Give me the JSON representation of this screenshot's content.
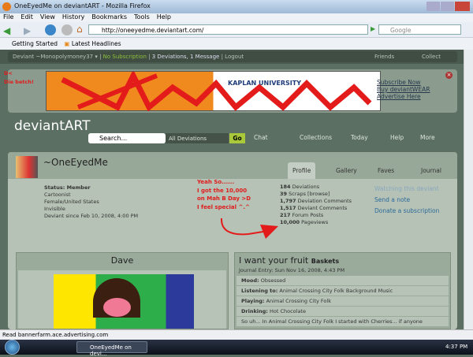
{
  "browser": {
    "title": "OneEyedMe on deviantART - Mozilla Firefox",
    "menu": [
      "File",
      "Edit",
      "View",
      "History",
      "Bookmarks",
      "Tools",
      "Help"
    ],
    "url": "http://oneeyedme.deviantart.com/",
    "search_placeholder": "Google",
    "bookmarks": [
      "Getting Started",
      "Latest Headlines"
    ],
    "status": "Read bannerfarm.ace.advertising.com"
  },
  "dabar": {
    "user": "Deviant ~Monopolymoney37",
    "subscription": "No Subscription",
    "counts": "3 Deviations, 1 Message",
    "logout": "Logout",
    "friends": "Friends",
    "collect": "Collect"
  },
  "ad": {
    "scribble": "D<\nDie betch!",
    "links": [
      "Subscribe Now",
      "Buy deviantWEAR",
      "Advertise Here"
    ],
    "brand": "KAPLAN UNIVERSITY"
  },
  "header": {
    "logo": "deviantART",
    "search_placeholder": "Search...",
    "scope": "All Deviations",
    "go": "Go",
    "nav": [
      "Chat",
      "Collections",
      "Today",
      "Help",
      "More"
    ]
  },
  "profile": {
    "name": "~OneEyedMe",
    "tabs": [
      "Profile",
      "Gallery",
      "Faves",
      "Journal"
    ],
    "info": [
      "Status: Member",
      "Cartoonist",
      "Female/United States",
      "Invisible",
      "Deviant since Feb 10, 2008, 4:00 PM"
    ],
    "annotation": [
      "Yeah So......",
      "I got the 10,000",
      "on Mah B Day >D",
      "I feel special ^.^"
    ],
    "stats": [
      {
        "n": "184",
        "l": "Deviations"
      },
      {
        "n": "39",
        "l": "Scraps [browse]"
      },
      {
        "n": "1,797",
        "l": "Deviation Comments"
      },
      {
        "n": "1,517",
        "l": "Deviant Comments"
      },
      {
        "n": "217",
        "l": "Forum Posts"
      },
      {
        "n": "10,000",
        "l": "Pageviews"
      }
    ],
    "actions": [
      "Watching this deviant",
      "Send a note",
      "Donate a subscription"
    ]
  },
  "featured": {
    "title": "Dave"
  },
  "journal": {
    "title": "I want your fruit",
    "title_small": "Baskets",
    "date": "Journal Entry: Sun Nov 16, 2008, 4:43 PM",
    "rows": [
      {
        "k": "Mood:",
        "v": "Obsessed"
      },
      {
        "k": "Listening to:",
        "v": "Animal Crossing City Folk Background Music"
      },
      {
        "k": "Playing:",
        "v": "Animal Crossing City Folk"
      },
      {
        "k": "Drinking:",
        "v": "Hot Chocolate"
      }
    ],
    "body": "So uh... In Animal Crossing City Folk I started with Cherries... if anyone"
  },
  "taskbar": {
    "window": "OneEyedMe on devi...",
    "clock": "4:37 PM"
  }
}
